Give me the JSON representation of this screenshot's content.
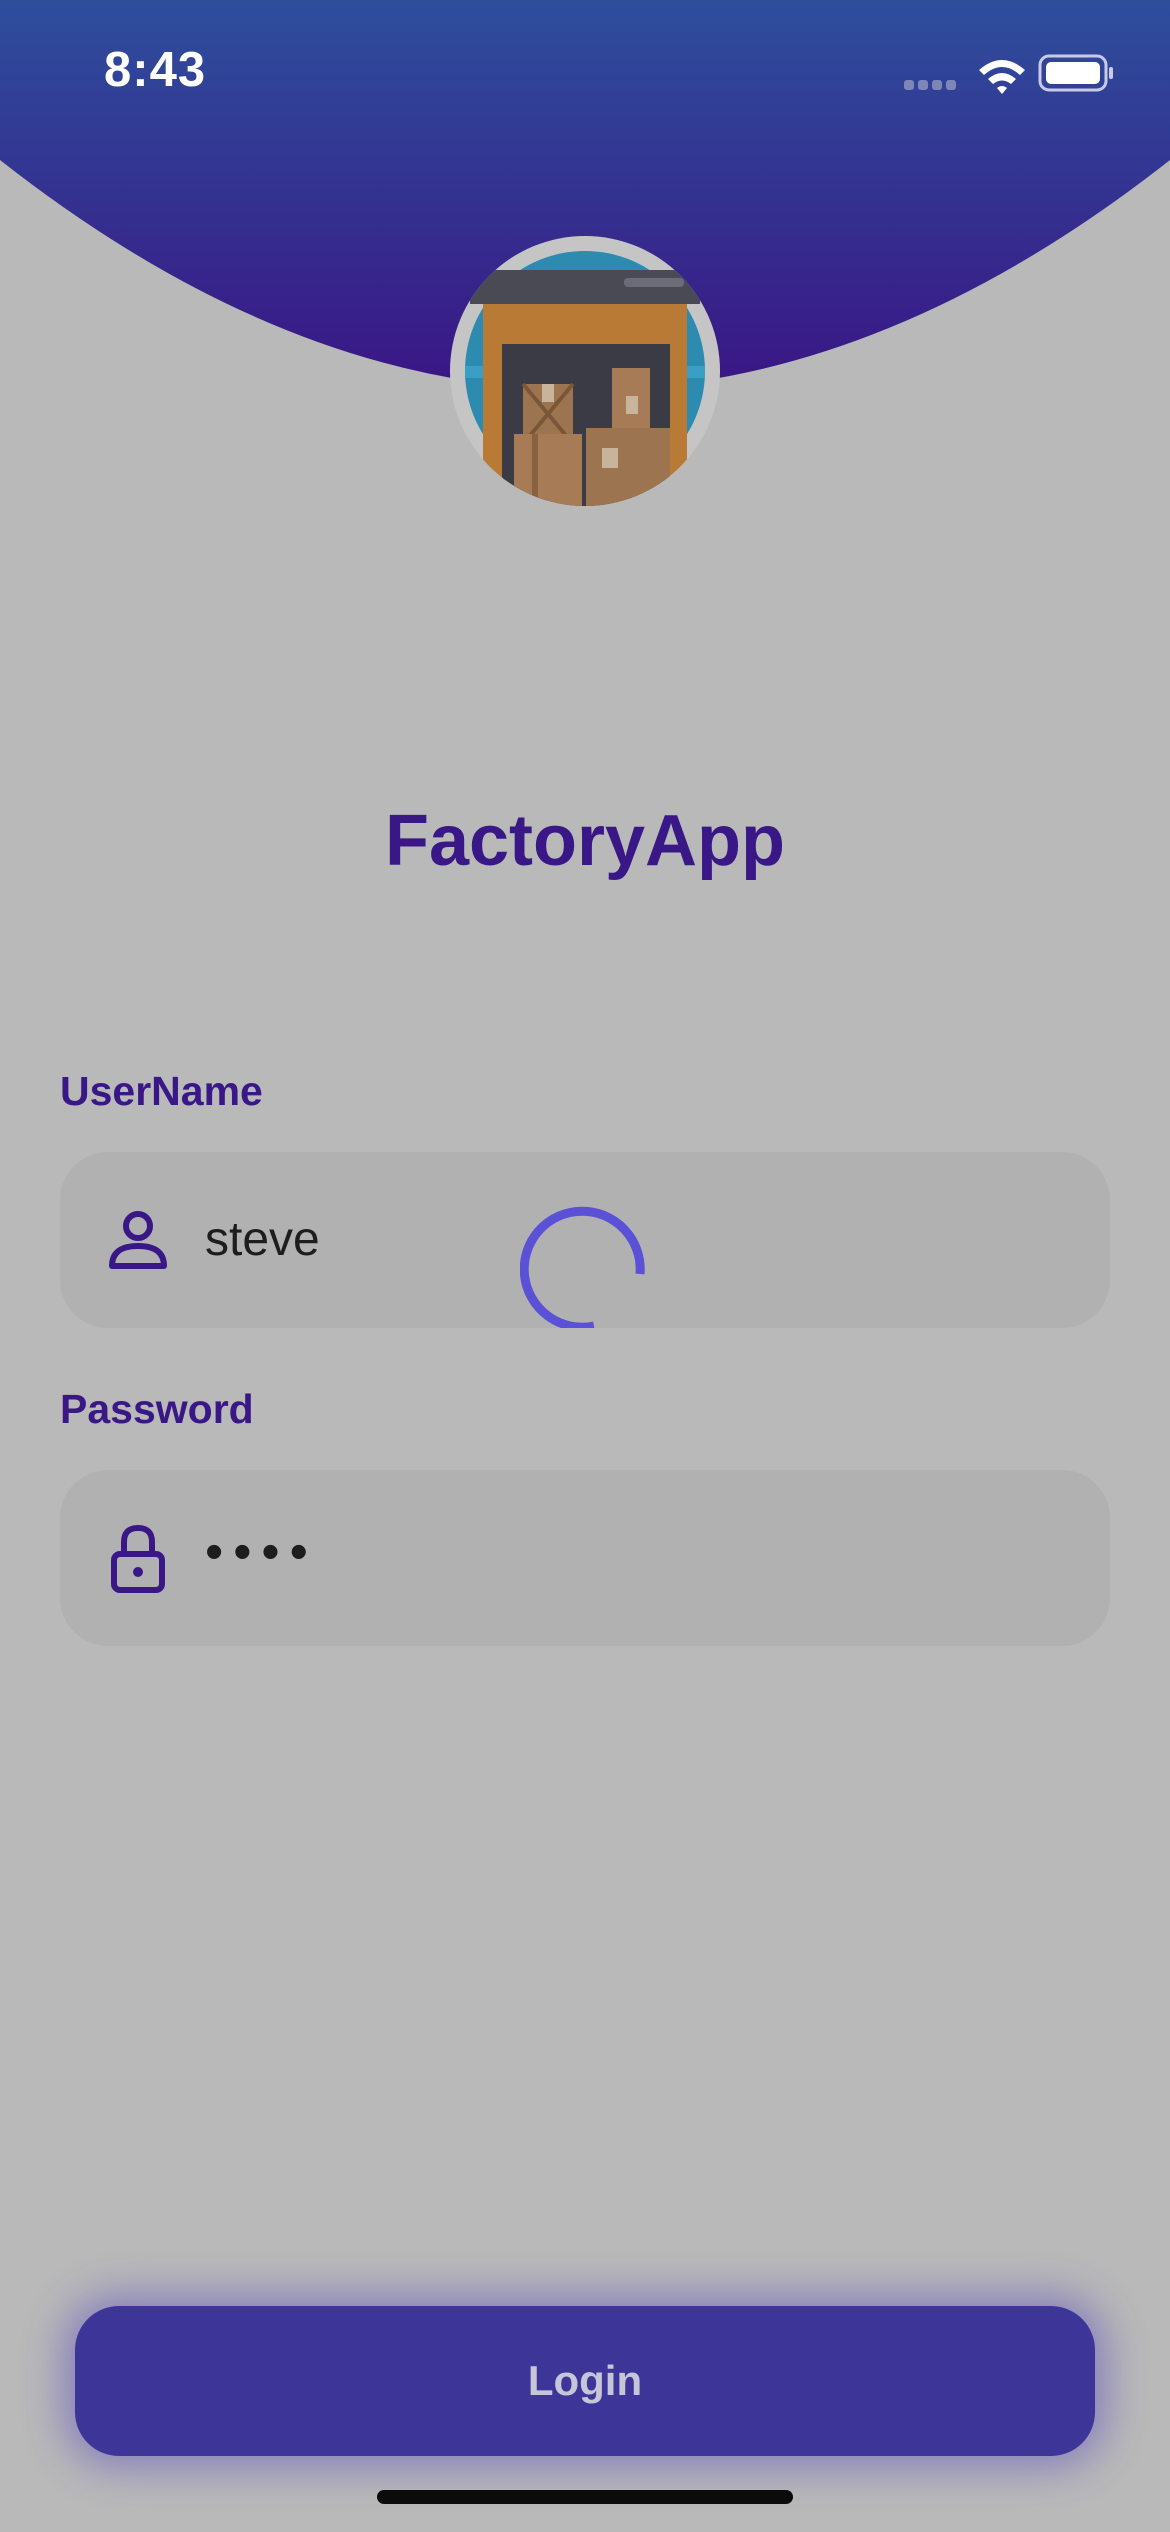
{
  "status_bar": {
    "time": "8:43"
  },
  "app": {
    "title": "FactoryApp"
  },
  "form": {
    "username": {
      "label": "UserName",
      "value": "steve",
      "icon": "person-icon"
    },
    "password": {
      "label": "Password",
      "value": "••••",
      "icon": "lock-icon"
    }
  },
  "actions": {
    "login_label": "Login"
  },
  "colors": {
    "primary": "#3a1787",
    "button": "#3e3598",
    "spinner": "#5b51d6",
    "header_top": "#2e4e9c",
    "header_bottom": "#3a1585"
  }
}
